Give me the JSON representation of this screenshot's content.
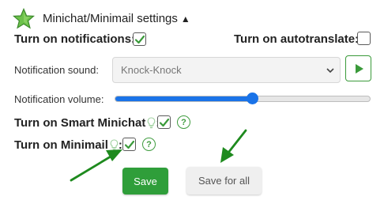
{
  "header": {
    "title": "Minichat/Minimail settings",
    "collapse_glyph": "▲",
    "icon": "star-icon"
  },
  "notifications": {
    "label": "Turn on notifications:",
    "checked": true
  },
  "autotranslate": {
    "label": "Turn on autotranslate:",
    "checked": false
  },
  "sound": {
    "label": "Notification sound:",
    "selected": "Knock-Knock",
    "play_icon": "play-icon"
  },
  "volume": {
    "label": "Notification volume:",
    "level_percent": 54
  },
  "smart_minichat": {
    "label": "Turn on Smart Minichat",
    "colon": ":",
    "checked": true,
    "help_glyph": "?",
    "hint_icon": "lightbulb-icon"
  },
  "minimail": {
    "label": "Turn on Minimail",
    "colon": ":",
    "checked": true,
    "help_glyph": "?",
    "hint_icon": "lightbulb-icon"
  },
  "buttons": {
    "save": "Save",
    "save_all": "Save for all"
  },
  "colors": {
    "accent_green": "#2f9e3a",
    "slider_blue": "#1a73e8",
    "arrow_green": "#1e8a1e"
  }
}
